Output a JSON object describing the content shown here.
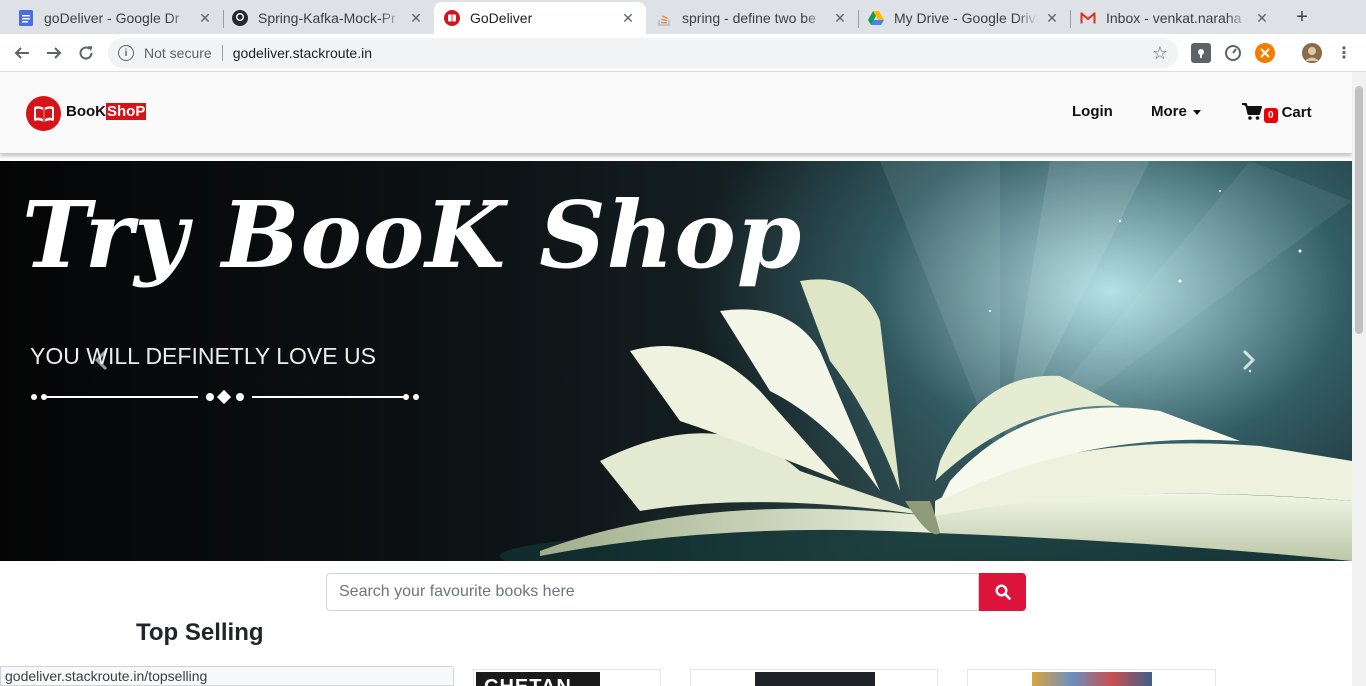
{
  "browser": {
    "tabs": [
      {
        "title": "goDeliver - Google Dr",
        "icon": "google-docs-icon",
        "active": false
      },
      {
        "title": "Spring-Kafka-Mock-Pr",
        "icon": "github-icon",
        "active": false
      },
      {
        "title": "GoDeliver",
        "icon": "godeliver-icon",
        "active": true
      },
      {
        "title": "spring - define two be",
        "icon": "stackoverflow-icon",
        "active": false
      },
      {
        "title": "My Drive - Google Driv",
        "icon": "google-drive-icon",
        "active": false
      },
      {
        "title": "Inbox - venkat.naraha",
        "icon": "gmail-icon",
        "active": false
      }
    ],
    "security_label": "Not secure",
    "url": "godeliver.stackroute.in",
    "status_url": "godeliver.stackroute.in/topselling"
  },
  "navbar": {
    "brand_part1": "BooK",
    "brand_part2": "ShoP",
    "login": "Login",
    "more": "More",
    "cart_count": "0",
    "cart": "Cart"
  },
  "hero": {
    "title": "Try BooK Shop",
    "subtitle": "YOU WILL DEFINETLY LOVE US"
  },
  "search": {
    "placeholder": "Search your favourite books here"
  },
  "top_selling": {
    "title": "Top Selling",
    "first_cover_text": "CHETAN"
  },
  "colors": {
    "brand_red": "#d7131a",
    "search_button": "#dc143c",
    "badge": "#ee0000"
  }
}
